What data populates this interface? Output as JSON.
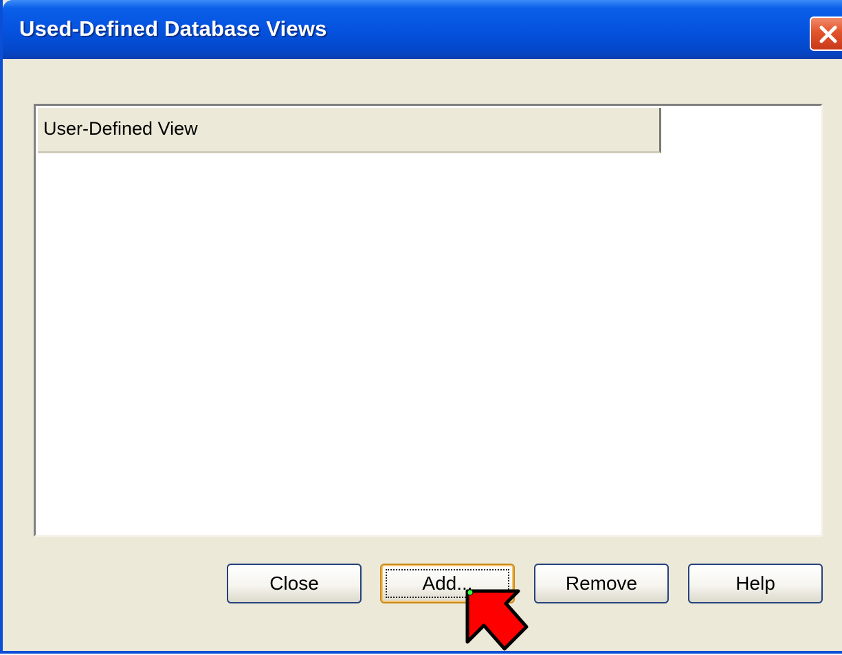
{
  "window": {
    "title": "Used-Defined Database Views"
  },
  "titlebar": {
    "close_icon": "close-icon"
  },
  "listview": {
    "columns": [
      "User-Defined View"
    ],
    "rows": []
  },
  "buttons": {
    "close_label": "Close",
    "add_label": "Add...",
    "remove_label": "Remove",
    "help_label": "Help"
  },
  "overlay": {
    "pointer_icon": "red-arrow-pointer-icon",
    "pointer_color": "#ff0000"
  },
  "colors": {
    "titlebar": "#0553e0",
    "dialog_bg": "#ece9d8",
    "close_button": "#e2542b"
  }
}
